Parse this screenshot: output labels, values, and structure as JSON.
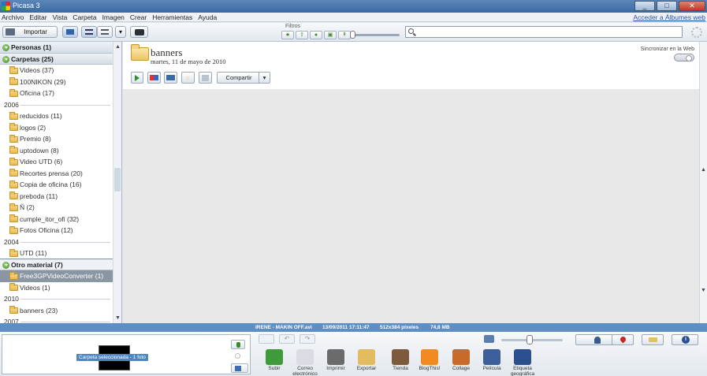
{
  "window": {
    "title": "Picasa 3",
    "minimize": "_",
    "maximize": "□",
    "close": "✕"
  },
  "menu": {
    "items": [
      "Archivo",
      "Editar",
      "Vista",
      "Carpeta",
      "Imagen",
      "Crear",
      "Herramientas",
      "Ayuda"
    ],
    "albums_link": "Acceder a Álbumes web"
  },
  "toolbar": {
    "import_label": "Importar",
    "filters_label": "Filtros",
    "filter_icons": [
      "star-icon",
      "upload-icon",
      "person-icon",
      "video-icon",
      "geotag-icon"
    ],
    "search_value": "",
    "search_placeholder": ""
  },
  "sidebar": {
    "rows": [
      {
        "type": "header",
        "label": "Personas (1)"
      },
      {
        "type": "header",
        "label": "Carpetas (25)"
      },
      {
        "type": "item",
        "label": "Videos (37)"
      },
      {
        "type": "item",
        "label": "100NIKON (29)"
      },
      {
        "type": "item",
        "label": "Oficina (17)"
      },
      {
        "type": "year",
        "label": "2006"
      },
      {
        "type": "item",
        "label": "reducidos (11)"
      },
      {
        "type": "item",
        "label": "logos (2)"
      },
      {
        "type": "item",
        "label": "Premio (8)"
      },
      {
        "type": "item",
        "label": "uptodown (8)"
      },
      {
        "type": "item",
        "label": "Video UTD (6)"
      },
      {
        "type": "item",
        "label": "Recortes prensa (20)"
      },
      {
        "type": "item",
        "label": "Copia de oficina (16)"
      },
      {
        "type": "item",
        "label": "preboda (11)"
      },
      {
        "type": "item",
        "label": "Ñ (2)"
      },
      {
        "type": "item",
        "label": "cumple_itor_ofi (32)"
      },
      {
        "type": "item",
        "label": "Fotos Oficina (12)"
      },
      {
        "type": "year",
        "label": "2004"
      },
      {
        "type": "item",
        "label": "UTD (11)"
      },
      {
        "type": "header",
        "label": "Otro material (7)",
        "selected": true
      },
      {
        "type": "item",
        "label": "Free3GPVideoConverter (1)",
        "selected": true
      },
      {
        "type": "item",
        "label": "Videos (1)"
      },
      {
        "type": "year",
        "label": "2010"
      },
      {
        "type": "item",
        "label": "banners (23)"
      },
      {
        "type": "year",
        "label": "2007"
      }
    ]
  },
  "album": {
    "title": "banners",
    "date": "martes, 11 de mayo de 2010",
    "sync_label": "Sincronizar en la Web",
    "share_label": "Compartir"
  },
  "status": {
    "filename": "IRENE - MAKIN OFF.avi",
    "datetime": "13/09/2011 17:11:47",
    "dimensions": "512x384 píxeles",
    "size": "74,8 MB"
  },
  "tray": {
    "selection_label": "Carpeta seleccionada - 1 foto",
    "actions": [
      {
        "label": "Subir",
        "color": "#3f9b3a"
      },
      {
        "label": "Correo electrónico",
        "color": "#d9dde3"
      },
      {
        "label": "Imprimir",
        "color": "#6b6b6b"
      },
      {
        "label": "Exportar",
        "color": "#e3bc5f"
      },
      {
        "label": "Tienda",
        "color": "#7d5a3c"
      },
      {
        "label": "BlogThis!",
        "color": "#f28a1f"
      },
      {
        "label": "Collage",
        "color": "#c86a2a"
      },
      {
        "label": "Película",
        "color": "#3d5f9a"
      },
      {
        "label": "Etiqueta geográfica",
        "color": "#2b4f8f"
      }
    ]
  }
}
